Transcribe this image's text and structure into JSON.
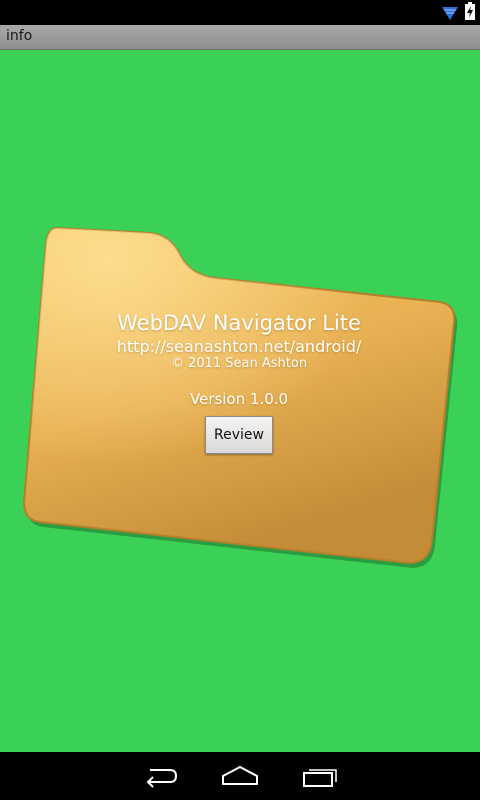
{
  "status_bar": {
    "icons": [
      "wifi-icon",
      "battery-charging-icon"
    ]
  },
  "title_bar": {
    "title": "info"
  },
  "about": {
    "app_name": "WebDAV Navigator Lite",
    "url": "http://seanashton.net/android/",
    "copyright": "© 2011 Sean Ashton",
    "version": "Version 1.0.0",
    "review_label": "Review"
  },
  "colors": {
    "background": "#3ad156",
    "folder_light": "#f2bf5c",
    "folder_dark": "#c9923a",
    "bar": "#000000"
  },
  "nav_bar": {
    "buttons": [
      "back-icon",
      "home-icon",
      "recent-apps-icon"
    ]
  }
}
